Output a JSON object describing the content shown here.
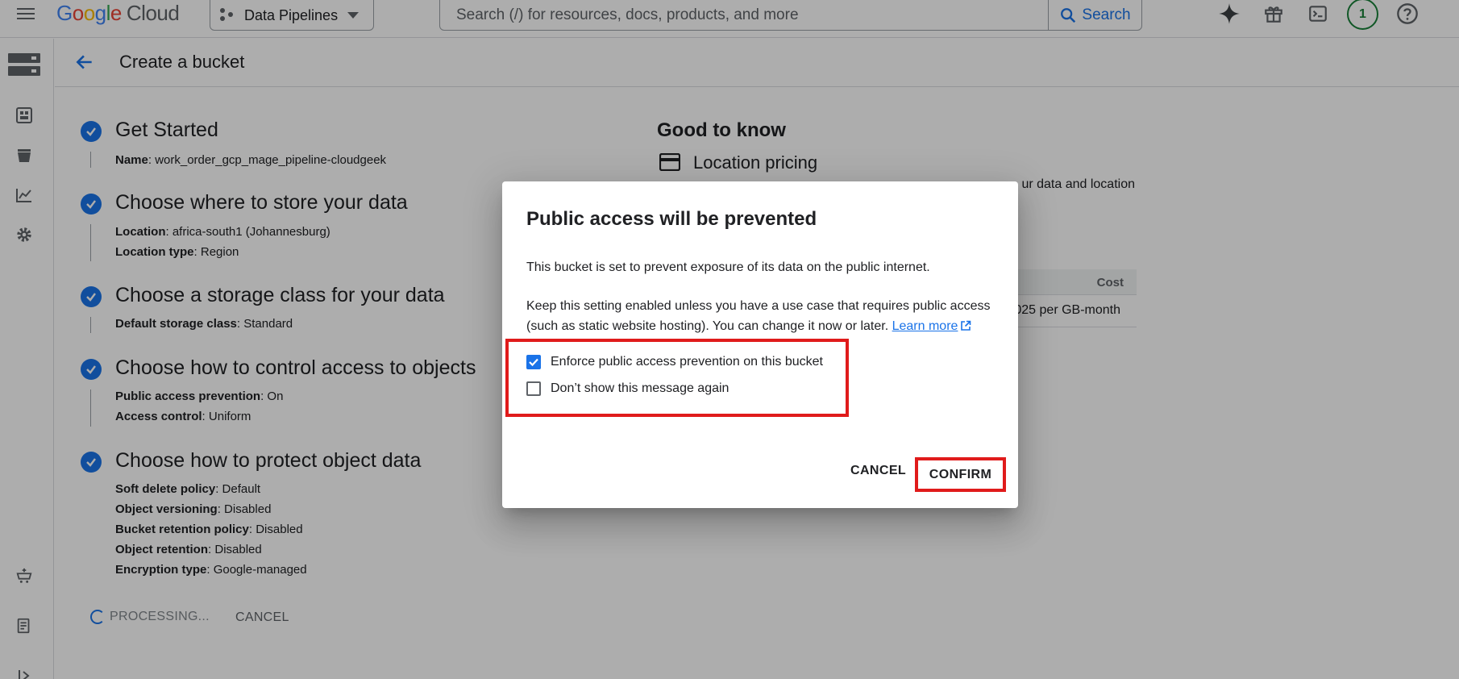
{
  "topbar": {
    "logo_google": "Google",
    "logo_cloud": "Cloud",
    "project": "Data Pipelines",
    "search_placeholder": "Search (/) for resources, docs, products, and more",
    "search_button": "Search",
    "notification_count": "1"
  },
  "page": {
    "title": "Create a bucket"
  },
  "steps": [
    {
      "title": "Get Started",
      "details": [
        {
          "label": "Name",
          "value": "work_order_gcp_mage_pipeline-cloudgeek"
        }
      ]
    },
    {
      "title": "Choose where to store your data",
      "details": [
        {
          "label": "Location",
          "value": "africa-south1 (Johannesburg)"
        },
        {
          "label": "Location type",
          "value": "Region"
        }
      ]
    },
    {
      "title": "Choose a storage class for your data",
      "details": [
        {
          "label": "Default storage class",
          "value": "Standard"
        }
      ]
    },
    {
      "title": "Choose how to control access to objects",
      "details": [
        {
          "label": "Public access prevention",
          "value": "On"
        },
        {
          "label": "Access control",
          "value": "Uniform"
        }
      ]
    },
    {
      "title": "Choose how to protect object data",
      "details": [
        {
          "label": "Soft delete policy",
          "value": "Default"
        },
        {
          "label": "Object versioning",
          "value": "Disabled"
        },
        {
          "label": "Bucket retention policy",
          "value": "Disabled"
        },
        {
          "label": "Object retention",
          "value": "Disabled"
        },
        {
          "label": "Encryption type",
          "value": "Google-managed"
        }
      ]
    }
  ],
  "footer": {
    "processing": "PROCESSING...",
    "cancel": "CANCEL"
  },
  "info_panel": {
    "title": "Good to know",
    "subtitle": "Location pricing",
    "text_fragment": "ur data and location",
    "table_header": "Cost",
    "table_row": "025 per GB-month"
  },
  "dialog": {
    "title": "Public access will be prevented",
    "paragraph1": "This bucket is set to prevent exposure of its data on the public internet.",
    "paragraph2": "Keep this setting enabled unless you have a use case that requires public access (such as static website hosting). You can change it now or later.",
    "learn_more": "Learn more",
    "checkbox1": {
      "label": "Enforce public access prevention on this bucket",
      "checked": true
    },
    "checkbox2": {
      "label": "Don’t show this message again",
      "checked": false
    },
    "cancel": "CANCEL",
    "confirm": "CONFIRM"
  },
  "colors": {
    "accent": "#1a73e8",
    "highlight": "#e01b1b",
    "scrim": "rgba(0,0,0,0.32)"
  },
  "icons": [
    "menu-icon",
    "project-icon",
    "search-icon",
    "gemini-icon",
    "gift-icon",
    "terminal-icon",
    "help-icon",
    "storage-icon",
    "dashboard-icon",
    "bucket-icon",
    "monitoring-icon",
    "settings-icon",
    "marketplace-icon",
    "release-notes-icon",
    "expand-icon",
    "back-arrow-icon",
    "check-icon",
    "credit-card-icon",
    "external-link-icon"
  ]
}
